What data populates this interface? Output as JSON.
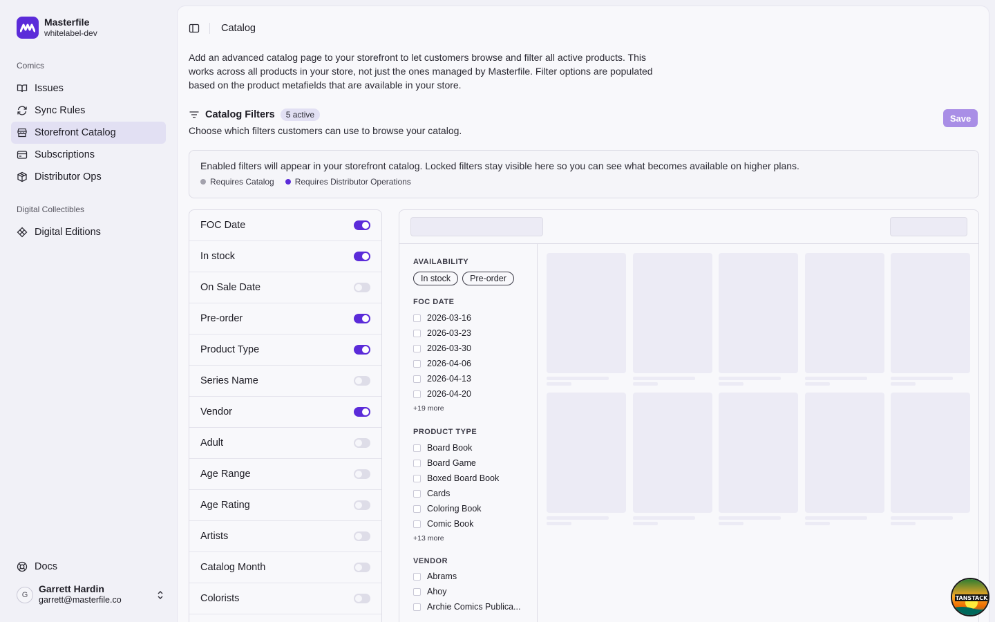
{
  "brand": {
    "name": "Masterfile",
    "workspace": "whitelabel-dev"
  },
  "sidebar": {
    "groups": [
      {
        "label": "Comics",
        "items": [
          {
            "label": "Issues",
            "icon": "book-open-icon",
            "active": false
          },
          {
            "label": "Sync Rules",
            "icon": "refresh-icon",
            "active": false
          },
          {
            "label": "Storefront Catalog",
            "icon": "store-icon",
            "active": true
          },
          {
            "label": "Subscriptions",
            "icon": "card-icon",
            "active": false
          },
          {
            "label": "Distributor Ops",
            "icon": "package-icon",
            "active": false
          }
        ]
      },
      {
        "label": "Digital Collectibles",
        "items": [
          {
            "label": "Digital Editions",
            "icon": "diamond-icon",
            "active": false
          }
        ]
      }
    ],
    "docs_label": "Docs",
    "user": {
      "initial": "G",
      "name": "Garrett Hardin",
      "email": "garrett@masterfile.co"
    }
  },
  "header": {
    "title": "Catalog"
  },
  "description": "Add an advanced catalog page to your storefront to let customers browse and filter all active products. This works across all products in your store, not just the ones managed by Masterfile. Filter options are populated based on the product metafields that are available in your store.",
  "filters": {
    "title": "Catalog Filters",
    "badge": "5 active",
    "subtitle": "Choose which filters customers can use to browse your catalog.",
    "save_label": "Save",
    "info": "Enabled filters will appear in your storefront catalog. Locked filters stay visible here so you can see what becomes available on higher plans.",
    "legend": [
      {
        "label": "Requires Catalog",
        "color": "#a3a2ad"
      },
      {
        "label": "Requires Distributor Operations",
        "color": "#5b2bd9"
      }
    ],
    "items": [
      {
        "label": "FOC Date",
        "enabled": true
      },
      {
        "label": "In stock",
        "enabled": true
      },
      {
        "label": "On Sale Date",
        "enabled": false
      },
      {
        "label": "Pre-order",
        "enabled": true
      },
      {
        "label": "Product Type",
        "enabled": true
      },
      {
        "label": "Series Name",
        "enabled": false
      },
      {
        "label": "Vendor",
        "enabled": true
      },
      {
        "label": "Adult",
        "enabled": false
      },
      {
        "label": "Age Range",
        "enabled": false
      },
      {
        "label": "Age Rating",
        "enabled": false
      },
      {
        "label": "Artists",
        "enabled": false
      },
      {
        "label": "Catalog Month",
        "enabled": false
      },
      {
        "label": "Colorists",
        "enabled": false
      }
    ]
  },
  "preview": {
    "availability": {
      "heading": "AVAILABILITY",
      "chips": [
        "In stock",
        "Pre-order"
      ]
    },
    "foc_date": {
      "heading": "FOC DATE",
      "options": [
        "2026-03-16",
        "2026-03-23",
        "2026-03-30",
        "2026-04-06",
        "2026-04-13",
        "2026-04-20"
      ],
      "more": "+19 more"
    },
    "product_type": {
      "heading": "PRODUCT TYPE",
      "options": [
        "Board Book",
        "Board Game",
        "Boxed Board Book",
        "Cards",
        "Coloring Book",
        "Comic Book"
      ],
      "more": "+13 more"
    },
    "vendor": {
      "heading": "VENDOR",
      "options": [
        "Abrams",
        "Ahoy",
        "Archie Comics Publica..."
      ]
    }
  },
  "colors": {
    "accent": "#5b2bd9",
    "save_bg": "#a98ee6",
    "active_nav": "#e2e0f3"
  }
}
